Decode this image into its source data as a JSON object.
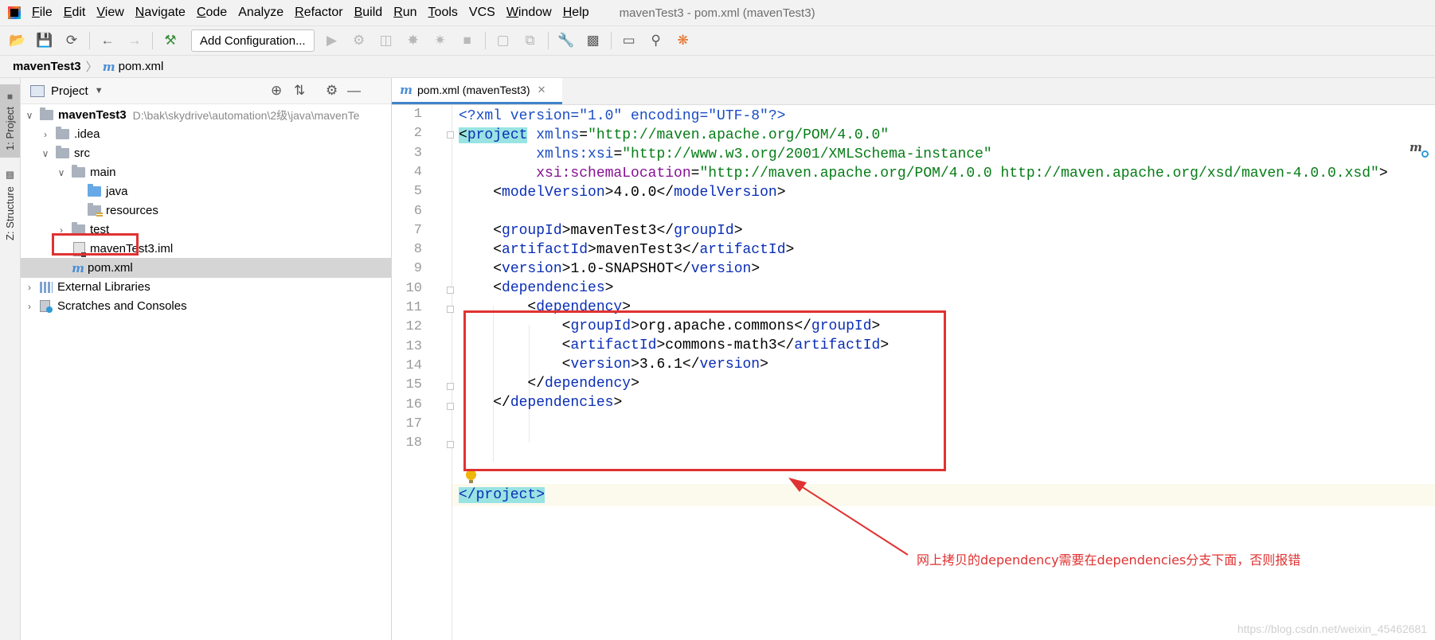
{
  "window_title": "mavenTest3 - pom.xml (mavenTest3)",
  "menu": [
    {
      "mn": "F",
      "rest": "ile"
    },
    {
      "mn": "E",
      "rest": "dit"
    },
    {
      "mn": "V",
      "rest": "iew"
    },
    {
      "mn": "N",
      "rest": "avigate"
    },
    {
      "mn": "C",
      "rest": "ode"
    },
    {
      "mn": "",
      "rest": "Analyze"
    },
    {
      "mn": "R",
      "rest": "efactor"
    },
    {
      "mn": "B",
      "rest": "uild"
    },
    {
      "mn": "R",
      "rest": "un"
    },
    {
      "mn": "T",
      "rest": "ools"
    },
    {
      "mn": "",
      "rest": "VCS"
    },
    {
      "mn": "W",
      "rest": "indow"
    },
    {
      "mn": "H",
      "rest": "elp"
    }
  ],
  "toolbar": {
    "add_configuration_label": "Add Configuration...",
    "icons_left": [
      "open-folder-icon",
      "save-icon",
      "sync-icon",
      "back-arrow-icon",
      "forward-arrow-icon",
      "build-hammer-icon"
    ],
    "icons_right": [
      "run-icon",
      "debug-icon",
      "coverage-icon",
      "profile-icon",
      "concurrency-icon",
      "stop-icon",
      "attach-icon",
      "update-icon",
      "settings-wrench-icon",
      "project-structure-icon",
      "terminal-icon",
      "search-icon",
      "plugin-icon"
    ]
  },
  "breadcrumb": {
    "project": "mavenTest3",
    "file": "pom.xml"
  },
  "tool_strip": {
    "project_label": "1: Project",
    "structure_label": "Z: Structure"
  },
  "project_panel": {
    "title": "Project",
    "tree": [
      {
        "label": "mavenTest3",
        "hint": "D:\\bak\\skydrive\\automation\\2级\\java\\mavenTe",
        "icon": "folder"
      },
      {
        "label": ".idea",
        "icon": "folder"
      },
      {
        "label": "src",
        "icon": "folder"
      },
      {
        "label": "main",
        "icon": "folder"
      },
      {
        "label": "java",
        "icon": "folder-blue"
      },
      {
        "label": "resources",
        "icon": "folder-resources"
      },
      {
        "label": "test",
        "icon": "folder"
      },
      {
        "label": "mavenTest3.iml",
        "icon": "iml-file"
      },
      {
        "label": "pom.xml",
        "icon": "maven-file"
      },
      {
        "label": "External Libraries",
        "icon": "library"
      },
      {
        "label": "Scratches and Consoles",
        "icon": "scratch"
      }
    ]
  },
  "editor": {
    "tab_label": "pom.xml (mavenTest3)",
    "line_numbers": [
      "1",
      "2",
      "3",
      "4",
      "5",
      "6",
      "7",
      "8",
      "9",
      "10",
      "11",
      "12",
      "13",
      "14",
      "15",
      "16",
      "17",
      "18"
    ],
    "code": {
      "l1_decl": "<?xml version=\"1.0\" encoding=\"UTF-8\"?>",
      "l2_tag": "project",
      "l2_attr": "xmlns",
      "l2_val": "\"http://maven.apache.org/POM/4.0.0\"",
      "l3_ns": "xmlns:xsi",
      "l3_val": "\"http://www.w3.org/2001/XMLSchema-instance\"",
      "l4_ns": "xsi:schemaLocation",
      "l4_val": "\"http://maven.apache.org/POM/4.0.0 http://maven.apache.org/xsd/maven-4.0.0.xsd\"",
      "modelVersion_tag": "modelVersion",
      "modelVersion_val": "4.0.0",
      "groupId_tag": "groupId",
      "groupId_val": "mavenTest3",
      "artifactId_tag": "artifactId",
      "artifactId_val": "mavenTest3",
      "version_tag": "version",
      "version_val": "1.0-SNAPSHOT",
      "dependencies_tag": "dependencies",
      "dependency_tag": "dependency",
      "dep_groupId_val": "org.apache.commons",
      "dep_artifactId_val": "commons-math3",
      "dep_version_val": "3.6.1",
      "project_close": "</project>"
    }
  },
  "annotation": {
    "text": "网上拷贝的dependency需要在dependencies分支下面，否则报错",
    "color": "#e03232"
  },
  "watermark": "https://blog.csdn.net/weixin_45462681"
}
